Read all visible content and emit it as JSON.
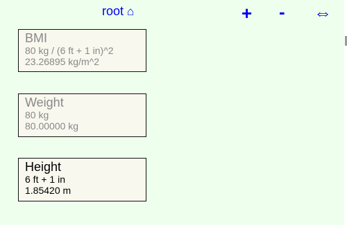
{
  "toolbar": {
    "root_label": "root",
    "root_icon": "⌂",
    "expand_label": "+",
    "collapse_label": "-",
    "resize_label": "⇔"
  },
  "cards": [
    {
      "title": "BMI",
      "expression": "80 kg / (6 ft + 1 in)^2",
      "result": "23.26895 kg/m^2"
    },
    {
      "title": "Weight",
      "expression": "80 kg",
      "result": "80.00000 kg"
    },
    {
      "title": "Height",
      "expression": "6 ft + 1 in",
      "result": "1.85420 m"
    }
  ],
  "colors": {
    "background": "#eeffee",
    "card_background": "#f8f8ee",
    "link": "#0000ee",
    "inactive_text": "#888888",
    "active_text": "#000000"
  },
  "icons": {
    "root": "home-icon",
    "expand": "plus-icon",
    "collapse": "minus-icon",
    "resize": "horizontal-resize-icon"
  }
}
